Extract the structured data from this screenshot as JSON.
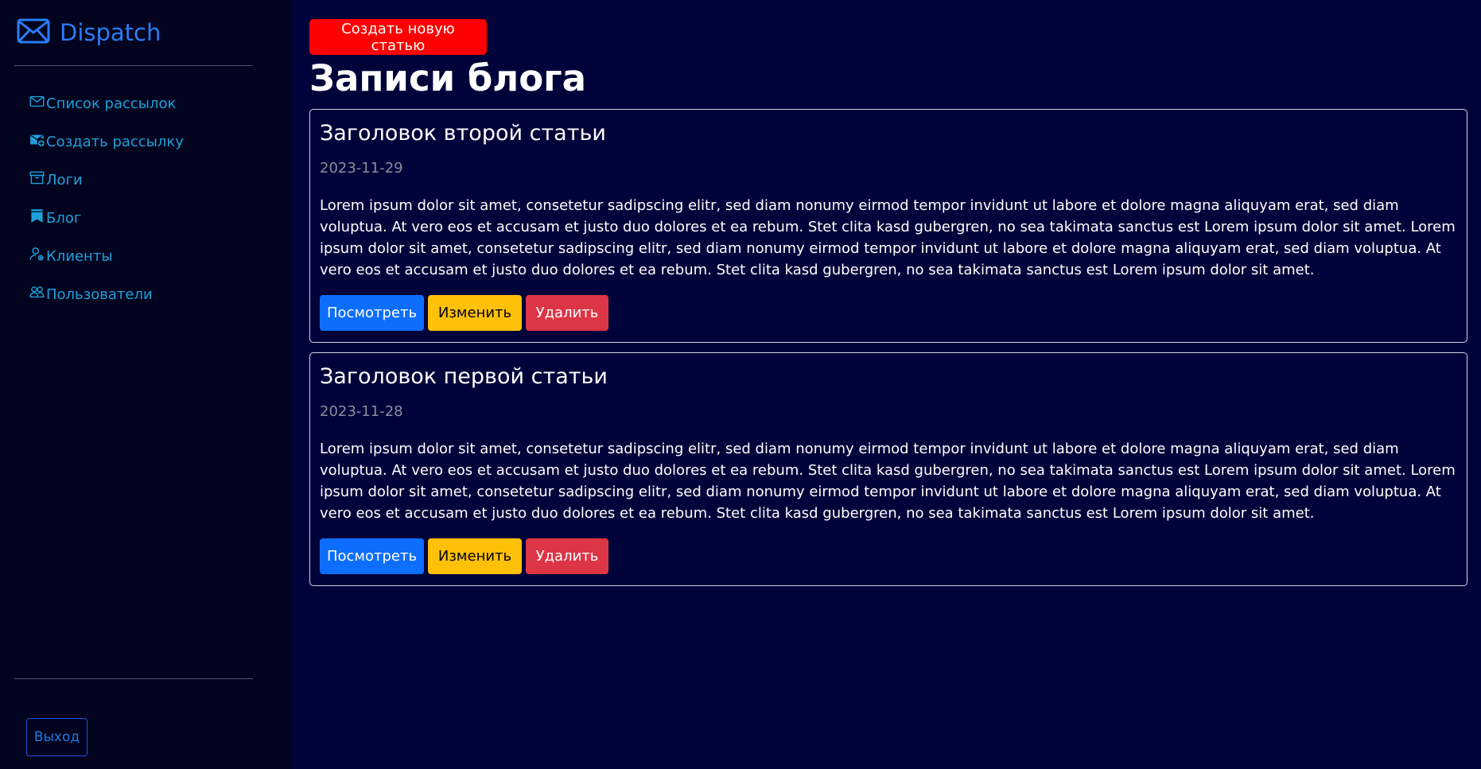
{
  "sidebar": {
    "brand": "Dispatch",
    "nav": [
      {
        "label": "Список рассылок",
        "icon": "envelope-icon"
      },
      {
        "label": "Создать рассылку",
        "icon": "envelope-plus-icon"
      },
      {
        "label": "Логи",
        "icon": "archive-icon"
      },
      {
        "label": "Блог",
        "icon": "bookmarks-icon"
      },
      {
        "label": "Клиенты",
        "icon": "person-gear-icon"
      },
      {
        "label": "Пользователи",
        "icon": "people-icon"
      }
    ],
    "logout_label": "Выход"
  },
  "main": {
    "create_label": "Создать новую статью",
    "page_title": "Записи блога",
    "posts": [
      {
        "title": "Заголовок второй статьи",
        "date": "2023-11-29",
        "body": "Lorem ipsum dolor sit amet, consetetur sadipscing elitr, sed diam nonumy eirmod tempor invidunt ut labore et dolore magna aliquyam erat, sed diam voluptua. At vero eos et accusam et justo duo dolores et ea rebum. Stet clita kasd gubergren, no sea takimata sanctus est Lorem ipsum dolor sit amet. Lorem ipsum dolor sit amet, consetetur sadipscing elitr, sed diam nonumy eirmod tempor invidunt ut labore et dolore magna aliquyam erat, sed diam voluptua. At vero eos et accusam et justo duo dolores et ea rebum. Stet clita kasd gubergren, no sea takimata sanctus est Lorem ipsum dolor sit amet.",
        "view_label": "Посмотреть",
        "edit_label": "Изменить",
        "delete_label": "Удалить"
      },
      {
        "title": "Заголовок первой статьи",
        "date": "2023-11-28",
        "body": "Lorem ipsum dolor sit amet, consetetur sadipscing elitr, sed diam nonumy eirmod tempor invidunt ut labore et dolore magna aliquyam erat, sed diam voluptua. At vero eos et accusam et justo duo dolores et ea rebum. Stet clita kasd gubergren, no sea takimata sanctus est Lorem ipsum dolor sit amet. Lorem ipsum dolor sit amet, consetetur sadipscing elitr, sed diam nonumy eirmod tempor invidunt ut labore et dolore magna aliquyam erat, sed diam voluptua. At vero eos et accusam et justo duo dolores et ea rebum. Stet clita kasd gubergren, no sea takimata sanctus est Lorem ipsum dolor sit amet.",
        "view_label": "Посмотреть",
        "edit_label": "Изменить",
        "delete_label": "Удалить"
      }
    ]
  },
  "colors": {
    "background": "#000339",
    "sidebar": "#01031f",
    "brand": "#2a7df4",
    "nav_link": "#1ea0d8",
    "create": "#ff0000",
    "view": "#0d6efd",
    "edit": "#ffc107",
    "delete": "#dc3545"
  }
}
